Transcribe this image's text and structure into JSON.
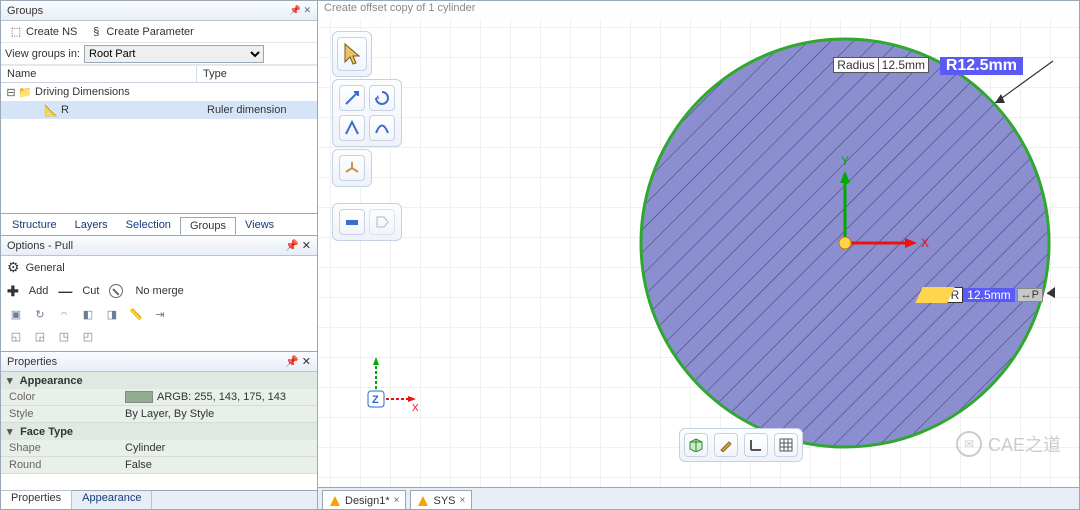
{
  "groups_panel": {
    "title": "Groups",
    "create_ns": "Create NS",
    "create_param": "Create Parameter",
    "view_label": "View groups in:",
    "view_value": "Root Part",
    "cols": {
      "name": "Name",
      "type": "Type"
    },
    "tree": [
      {
        "label": "Driving Dimensions",
        "icon": "folder",
        "expanded": true,
        "type": ""
      },
      {
        "label": "R",
        "icon": "ruler",
        "type": "Ruler dimension",
        "indent": 1,
        "selected": true
      }
    ]
  },
  "struct_tabs": [
    "Structure",
    "Layers",
    "Selection",
    "Groups",
    "Views"
  ],
  "struct_active": "Groups",
  "options": {
    "title": "Options - Pull",
    "general": "General",
    "add": "Add",
    "cut": "Cut",
    "nomerge": "No merge"
  },
  "properties": {
    "title": "Properties",
    "rows": [
      {
        "k": "color",
        "name": "Color",
        "swatch": "#ffaf8f",
        "value": "ARGB: 255, 143, 175, 143",
        "cat": "Appearance"
      },
      {
        "k": "style",
        "name": "Style",
        "value": "By Layer, By Style",
        "cat": "Appearance"
      },
      {
        "k": "shape",
        "name": "Shape",
        "value": "Cylinder",
        "cat": "Face Type"
      },
      {
        "k": "round",
        "name": "Round",
        "value": "False",
        "cat": "Face Type"
      }
    ],
    "cat_appearance": "Appearance",
    "cat_facetype": "Face Type"
  },
  "bottom_tabs": [
    "Properties",
    "Appearance"
  ],
  "bottom_active": "Properties",
  "canvas": {
    "status": "Create offset copy of 1 cylinder",
    "radius_label": "Radius",
    "radius_value": "12.5mm",
    "radius_big": "R12.5mm",
    "r_label": "R",
    "r_value": "12.5mm",
    "p_label": "↔P",
    "cylinder_fill": "#8b8ecf",
    "cylinder_stroke": "#2fa82f"
  },
  "doc_tabs": [
    {
      "label": "Design1*",
      "logo": "#f5a300"
    },
    {
      "label": "SYS",
      "logo": "#f5a300"
    }
  ],
  "watermark": "CAE之道",
  "icons": {
    "gear": "⚙",
    "plus": "✚",
    "minus": "—",
    "cursor": "↖",
    "spin": "⟳",
    "measure": "📏"
  },
  "triad": {
    "x": "X",
    "y": "Y",
    "z": "Z"
  }
}
